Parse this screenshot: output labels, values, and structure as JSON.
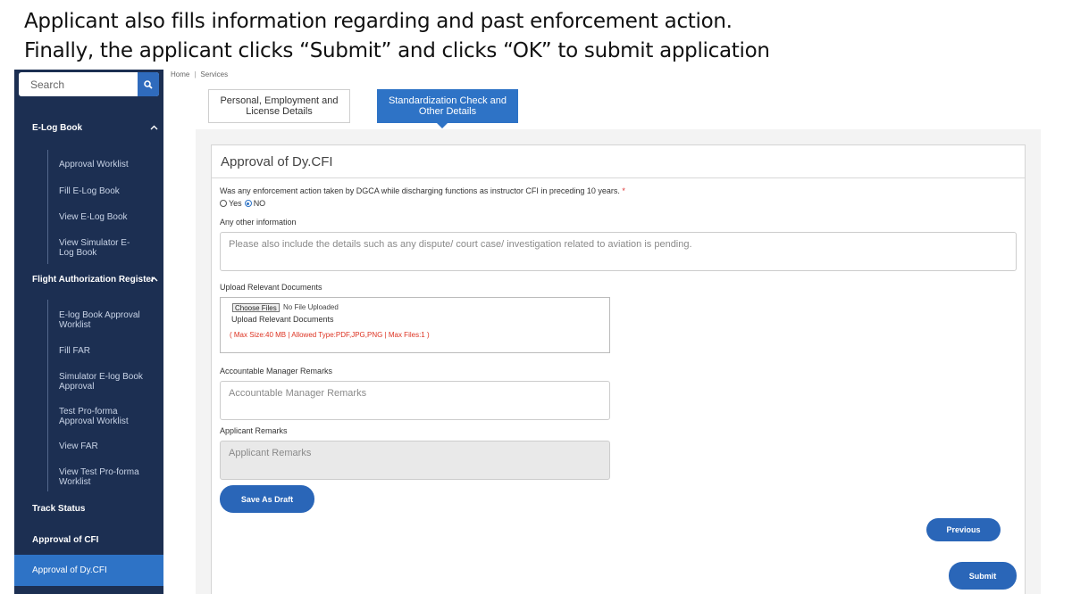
{
  "caption": {
    "line1": "Applicant also fills information regarding and past enforcement action.",
    "line2": "Finally, the applicant clicks “Submit” and clicks “OK” to submit application"
  },
  "sidebar": {
    "search_placeholder": "Search",
    "sections": {
      "elog": {
        "label": "E-Log Book",
        "items": [
          "Approval Worklist",
          "Fill E-Log Book",
          "View E-Log Book",
          "View Simulator E-Log Book"
        ]
      },
      "far": {
        "label": "Flight Authorization Register",
        "items": [
          "E-log Book Approval Worklist",
          "Fill FAR",
          "Simulator E-log Book Approval",
          "Test Pro-forma Approval Worklist",
          "View FAR",
          "View Test Pro-forma Worklist"
        ]
      }
    },
    "bottom": [
      "Track Status",
      "Approval of CFI",
      "Approval of Dy.CFI"
    ]
  },
  "breadcrumb": {
    "home": "Home",
    "services": "Services"
  },
  "tabs": [
    {
      "label": "Personal, Employment and License Details"
    },
    {
      "label": "Standardization Check and Other Details"
    }
  ],
  "form": {
    "title": "Approval of Dy.CFI",
    "question": "Was any enforcement action taken by DGCA while discharging functions as instructor CFI in preceding 10 years.",
    "required_mark": "*",
    "options": {
      "yes": "Yes",
      "no": "NO"
    },
    "selected": "NO",
    "other_info_label": "Any other information",
    "other_info_placeholder": "Please also include the details such as any dispute/ court case/ investigation related to aviation is pending.",
    "upload_label": "Upload Relevant Documents",
    "choose_files": "Choose Files",
    "no_file": "No File Uploaded",
    "upload_title": "Upload Relevant Documents",
    "upload_hint": "( Max Size:40 MB | Allowed Type:PDF,JPG,PNG | Max Files:1 )",
    "manager_label": "Accountable Manager Remarks",
    "manager_placeholder": "Accountable Manager Remarks",
    "applicant_label": "Applicant Remarks",
    "applicant_placeholder": "Applicant Remarks"
  },
  "buttons": {
    "save_draft": "Save As Draft",
    "previous": "Previous",
    "submit": "Submit"
  },
  "colors": {
    "sidebar": "#1c2f52",
    "accent": "#2e73c6",
    "button": "#2a66b8",
    "hint": "#d32222"
  }
}
